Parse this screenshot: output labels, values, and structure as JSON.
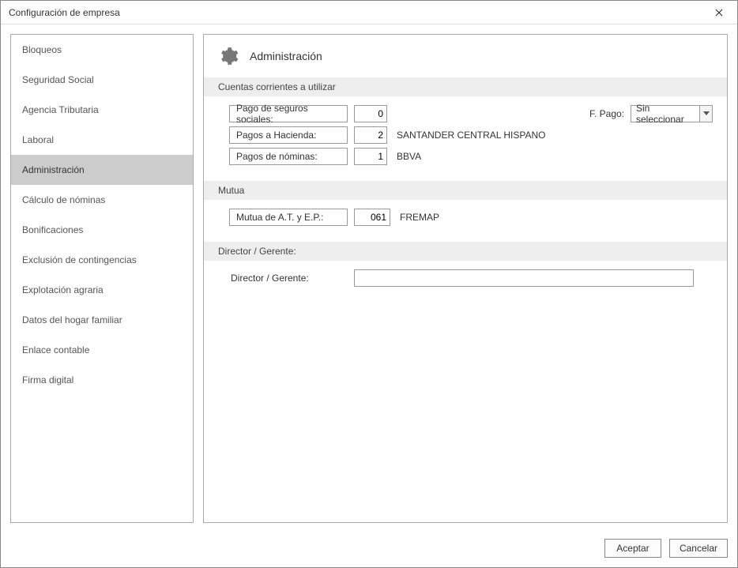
{
  "window": {
    "title": "Configuración de empresa"
  },
  "sidebar": {
    "items": [
      {
        "label": "Bloqueos",
        "selected": false
      },
      {
        "label": "Seguridad Social",
        "selected": false
      },
      {
        "label": "Agencia Tributaria",
        "selected": false
      },
      {
        "label": "Laboral",
        "selected": false
      },
      {
        "label": "Administración",
        "selected": true
      },
      {
        "label": "Cálculo de nóminas",
        "selected": false
      },
      {
        "label": "Bonificaciones",
        "selected": false
      },
      {
        "label": "Exclusión de contingencias",
        "selected": false
      },
      {
        "label": "Explotación agraria",
        "selected": false
      },
      {
        "label": "Datos del hogar familiar",
        "selected": false
      },
      {
        "label": "Enlace contable",
        "selected": false
      },
      {
        "label": "Firma digital",
        "selected": false
      }
    ]
  },
  "panel": {
    "title": "Administración",
    "sections": {
      "cuentas": {
        "heading": "Cuentas corrientes a utilizar",
        "rows": {
          "seg_sociales": {
            "label": "Pago de seguros sociales:",
            "code": "0",
            "name": ""
          },
          "hacienda": {
            "label": "Pagos a Hacienda:",
            "code": "2",
            "name": "SANTANDER CENTRAL HISPANO"
          },
          "nominas": {
            "label": "Pagos de nóminas:",
            "code": "1",
            "name": "BBVA"
          }
        },
        "fpago": {
          "label": "F. Pago:",
          "value": "Sin seleccionar"
        }
      },
      "mutua": {
        "heading": "Mutua",
        "row": {
          "label": "Mutua de A.T. y E.P.:",
          "code": "061",
          "name": "FREMAP"
        }
      },
      "director": {
        "heading": "Director / Gerente:",
        "row": {
          "label": "Director / Gerente:",
          "value": ""
        }
      }
    }
  },
  "footer": {
    "accept": "Aceptar",
    "cancel": "Cancelar"
  }
}
